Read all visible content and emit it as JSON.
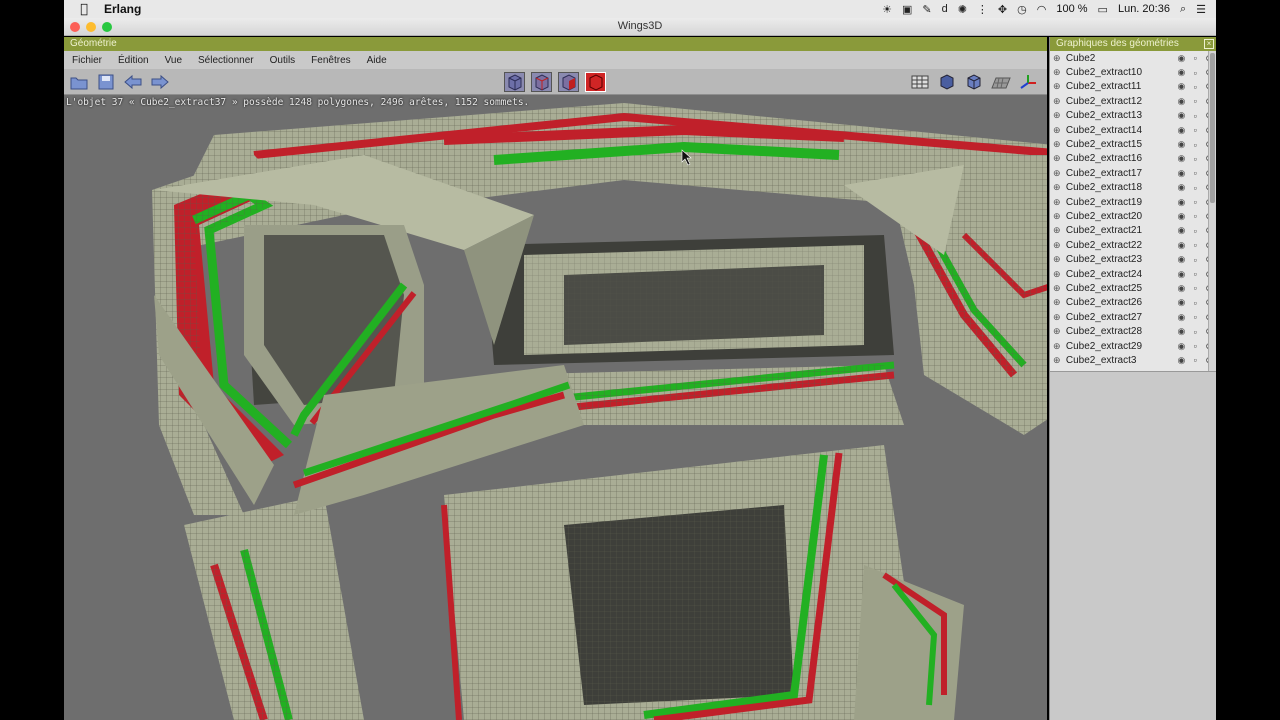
{
  "mac": {
    "app_name": "Erlang",
    "battery": "100 %",
    "clock": "Lun. 20:36"
  },
  "window": {
    "title": "Wings3D"
  },
  "geometry": {
    "header": "Géométrie",
    "menus": [
      "Fichier",
      "Édition",
      "Vue",
      "Sélectionner",
      "Outils",
      "Fenêtres",
      "Aide"
    ],
    "status": "L'objet 37 « Cube2_extract37 » possède 1248 polygones, 2496 arêtes, 1152 sommets."
  },
  "outliner": {
    "header": "Graphiques des géométries",
    "items": [
      "Cube2",
      "Cube2_extract10",
      "Cube2_extract11",
      "Cube2_extract12",
      "Cube2_extract13",
      "Cube2_extract14",
      "Cube2_extract15",
      "Cube2_extract16",
      "Cube2_extract17",
      "Cube2_extract18",
      "Cube2_extract19",
      "Cube2_extract20",
      "Cube2_extract21",
      "Cube2_extract22",
      "Cube2_extract23",
      "Cube2_extract24",
      "Cube2_extract25",
      "Cube2_extract26",
      "Cube2_extract27",
      "Cube2_extract28",
      "Cube2_extract29",
      "Cube2_extract3"
    ]
  },
  "colors": {
    "header_green": "#8a9a3a",
    "mesh_face": "#a9ad95",
    "selected_red": "#c0202a",
    "selected_green": "#22b022"
  },
  "icons": {
    "toolbar_left": [
      "open-folder-icon",
      "save-icon",
      "undo-icon",
      "redo-icon"
    ],
    "select_modes": [
      "vertex-mode-icon",
      "edge-mode-icon",
      "face-mode-icon",
      "body-mode-icon"
    ],
    "view_modes": [
      "wireframe-icon",
      "smooth-shaded-icon",
      "flat-shaded-icon",
      "ground-grid-icon",
      "axes-icon"
    ]
  }
}
